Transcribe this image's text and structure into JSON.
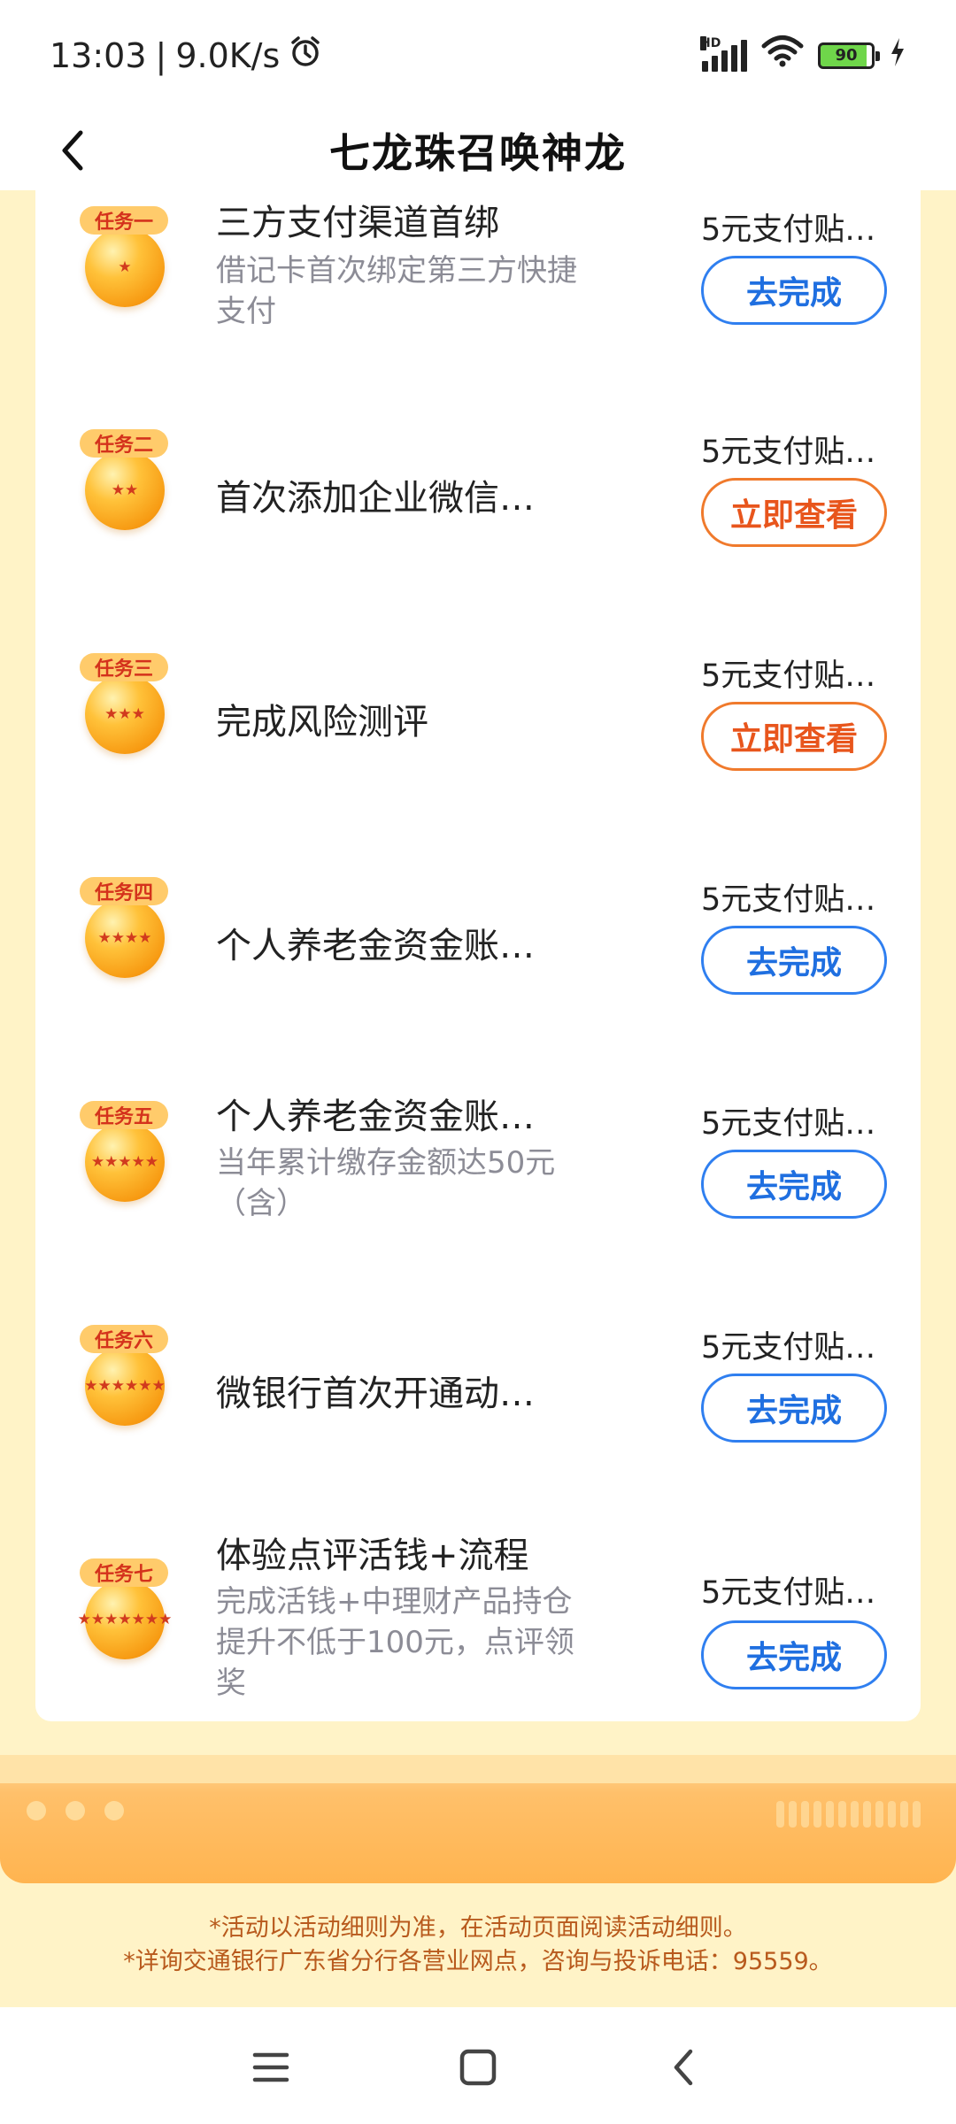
{
  "status_bar": {
    "time": "13:03",
    "speed": "9.0K/s",
    "network_tag": "HD",
    "battery": "90"
  },
  "header": {
    "title": "七龙珠召唤神龙"
  },
  "tasks": [
    {
      "tag": "任务一",
      "stars": "★",
      "title": "三方支付渠道首绑",
      "desc": "借记卡首次绑定第三方快捷支付",
      "reward": "5元支付贴…",
      "button": "去完成",
      "button_style": "blue"
    },
    {
      "tag": "任务二",
      "stars": "★★",
      "title": "首次添加企业微信…",
      "desc": "",
      "reward": "5元支付贴…",
      "button": "立即查看",
      "button_style": "orange"
    },
    {
      "tag": "任务三",
      "stars": "★★★",
      "title": "完成风险测评",
      "desc": "",
      "reward": "5元支付贴…",
      "button": "立即查看",
      "button_style": "orange"
    },
    {
      "tag": "任务四",
      "stars": "★★★★",
      "title": "个人养老金资金账…",
      "desc": "",
      "reward": "5元支付贴…",
      "button": "去完成",
      "button_style": "blue"
    },
    {
      "tag": "任务五",
      "stars": "★★★★★",
      "title": "个人养老金资金账…",
      "desc": "当年累计缴存金额达50元（含）",
      "reward": "5元支付贴…",
      "button": "去完成",
      "button_style": "blue"
    },
    {
      "tag": "任务六",
      "stars": "★★★★★★",
      "title": "微银行首次开通动…",
      "desc": "",
      "reward": "5元支付贴…",
      "button": "去完成",
      "button_style": "blue"
    },
    {
      "tag": "任务七",
      "stars": "★★★★★★★",
      "title": "体验点评活钱+流程",
      "desc": "完成活钱+中理财产品持仓提升不低于100元，点评领奖",
      "reward": "5元支付贴…",
      "button": "去完成",
      "button_style": "blue"
    }
  ],
  "footer": {
    "note1": "*活动以活动细则为准，在活动页面阅读活动细则。",
    "note2": "*详询交通银行广东省分行各营业网点，咨询与投诉电话：95559。"
  },
  "nav": {
    "menu_icon": "menu-icon",
    "home_icon": "home-square-icon",
    "back_icon": "back-chevron-icon"
  }
}
